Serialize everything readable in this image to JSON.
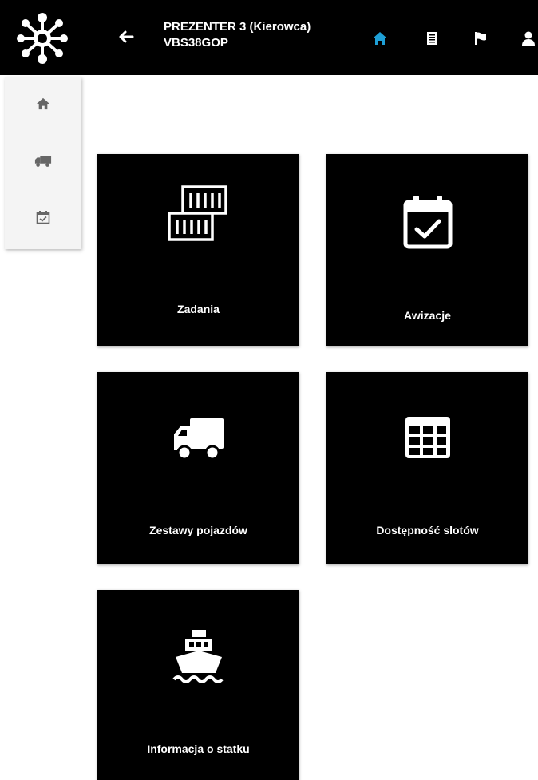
{
  "header": {
    "user_name": "PREZENTER 3 (Kierowca)",
    "vehicle_plate": "VBS38GOP",
    "icons": [
      "home-icon",
      "document-icon",
      "flag-icon",
      "user-icon"
    ],
    "active_color": "#1e9fd6"
  },
  "sidebar": {
    "items": [
      {
        "icon": "home-icon"
      },
      {
        "icon": "truck-icon"
      },
      {
        "icon": "calendar-check-icon"
      }
    ]
  },
  "tiles": [
    {
      "label": "Zadania",
      "icon": "containers-icon"
    },
    {
      "label": "Awizacje",
      "icon": "calendar-check-icon"
    },
    {
      "label": "Zestawy pojazdów",
      "icon": "truck-icon"
    },
    {
      "label": "Dostępność slotów",
      "icon": "grid-table-icon"
    },
    {
      "label": "Informacja o statku",
      "icon": "ship-icon"
    }
  ]
}
